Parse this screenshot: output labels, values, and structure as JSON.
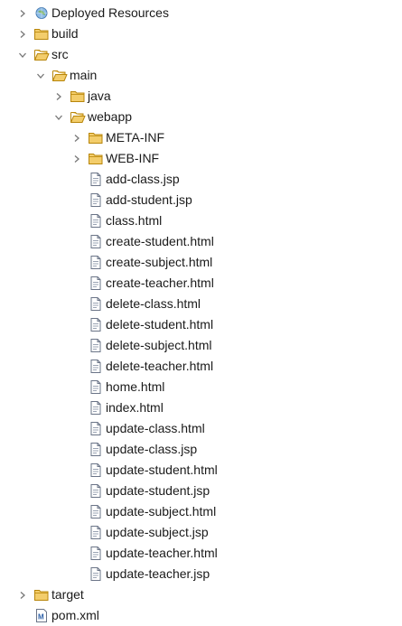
{
  "explorer": {
    "items": [
      {
        "label": "Deployed Resources",
        "depth": 0,
        "twisty": "collapsed",
        "icon": "deployed-resources-icon",
        "name": "deployed-resources"
      },
      {
        "label": "build",
        "depth": 0,
        "twisty": "collapsed",
        "icon": "folder-icon",
        "name": "build"
      },
      {
        "label": "src",
        "depth": 0,
        "twisty": "expanded",
        "icon": "folder-open-icon",
        "name": "src"
      },
      {
        "label": "main",
        "depth": 1,
        "twisty": "expanded",
        "icon": "folder-open-icon",
        "name": "main"
      },
      {
        "label": "java",
        "depth": 2,
        "twisty": "collapsed",
        "icon": "folder-icon",
        "name": "java"
      },
      {
        "label": "webapp",
        "depth": 2,
        "twisty": "expanded",
        "icon": "folder-open-icon",
        "name": "webapp"
      },
      {
        "label": "META-INF",
        "depth": 3,
        "twisty": "collapsed",
        "icon": "folder-icon",
        "name": "meta-inf"
      },
      {
        "label": "WEB-INF",
        "depth": 3,
        "twisty": "collapsed",
        "icon": "folder-icon",
        "name": "web-inf"
      },
      {
        "label": "add-class.jsp",
        "depth": 3,
        "twisty": "none",
        "icon": "file-icon",
        "name": "add-class-jsp"
      },
      {
        "label": "add-student.jsp",
        "depth": 3,
        "twisty": "none",
        "icon": "file-icon",
        "name": "add-student-jsp"
      },
      {
        "label": "class.html",
        "depth": 3,
        "twisty": "none",
        "icon": "file-icon",
        "name": "class-html"
      },
      {
        "label": "create-student.html",
        "depth": 3,
        "twisty": "none",
        "icon": "file-icon",
        "name": "create-student-html"
      },
      {
        "label": "create-subject.html",
        "depth": 3,
        "twisty": "none",
        "icon": "file-icon",
        "name": "create-subject-html"
      },
      {
        "label": "create-teacher.html",
        "depth": 3,
        "twisty": "none",
        "icon": "file-icon",
        "name": "create-teacher-html"
      },
      {
        "label": "delete-class.html",
        "depth": 3,
        "twisty": "none",
        "icon": "file-icon",
        "name": "delete-class-html"
      },
      {
        "label": "delete-student.html",
        "depth": 3,
        "twisty": "none",
        "icon": "file-icon",
        "name": "delete-student-html"
      },
      {
        "label": "delete-subject.html",
        "depth": 3,
        "twisty": "none",
        "icon": "file-icon",
        "name": "delete-subject-html"
      },
      {
        "label": "delete-teacher.html",
        "depth": 3,
        "twisty": "none",
        "icon": "file-icon",
        "name": "delete-teacher-html"
      },
      {
        "label": "home.html",
        "depth": 3,
        "twisty": "none",
        "icon": "file-icon",
        "name": "home-html"
      },
      {
        "label": "index.html",
        "depth": 3,
        "twisty": "none",
        "icon": "file-icon",
        "name": "index-html"
      },
      {
        "label": "update-class.html",
        "depth": 3,
        "twisty": "none",
        "icon": "file-icon",
        "name": "update-class-html"
      },
      {
        "label": "update-class.jsp",
        "depth": 3,
        "twisty": "none",
        "icon": "file-icon",
        "name": "update-class-jsp"
      },
      {
        "label": "update-student.html",
        "depth": 3,
        "twisty": "none",
        "icon": "file-icon",
        "name": "update-student-html"
      },
      {
        "label": "update-student.jsp",
        "depth": 3,
        "twisty": "none",
        "icon": "file-icon",
        "name": "update-student-jsp"
      },
      {
        "label": "update-subject.html",
        "depth": 3,
        "twisty": "none",
        "icon": "file-icon",
        "name": "update-subject-html"
      },
      {
        "label": "update-subject.jsp",
        "depth": 3,
        "twisty": "none",
        "icon": "file-icon",
        "name": "update-subject-jsp"
      },
      {
        "label": "update-teacher.html",
        "depth": 3,
        "twisty": "none",
        "icon": "file-icon",
        "name": "update-teacher-html"
      },
      {
        "label": "update-teacher.jsp",
        "depth": 3,
        "twisty": "none",
        "icon": "file-icon",
        "name": "update-teacher-jsp"
      },
      {
        "label": "target",
        "depth": 0,
        "twisty": "collapsed",
        "icon": "folder-icon",
        "name": "target"
      },
      {
        "label": "pom.xml",
        "depth": 0,
        "twisty": "none",
        "icon": "maven-pom-icon",
        "name": "pom-xml"
      }
    ]
  },
  "colors": {
    "folder_fill": "#f3cd6b",
    "folder_stroke": "#b8860b",
    "file_stroke": "#6a7487",
    "twisty": "#777777",
    "text": "#1a1a1a"
  }
}
